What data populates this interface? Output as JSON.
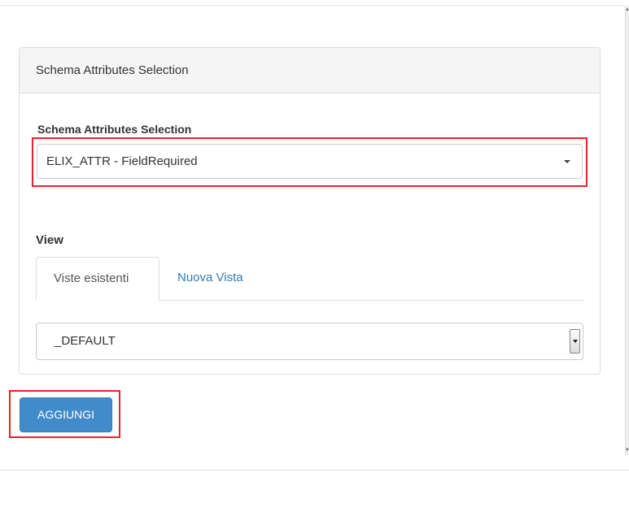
{
  "panel": {
    "heading": "Schema Attributes Selection"
  },
  "attributes": {
    "label": "Schema Attributes Selection",
    "selected_value": "ELIX_ATTR - FieldRequired",
    "dropdown_icon": "caret-down-icon"
  },
  "view": {
    "label": "View",
    "tabs": [
      {
        "label": "Viste esistenti",
        "active": true
      },
      {
        "label": "Nuova Vista",
        "active": false
      }
    ],
    "selected_value": "_DEFAULT",
    "dropdown_icon": "select-spinner-icon"
  },
  "actions": {
    "add_label": "AGGIUNGI"
  },
  "colors": {
    "highlight": "#e8222b",
    "primary": "#428bca",
    "link": "#337ab7"
  }
}
